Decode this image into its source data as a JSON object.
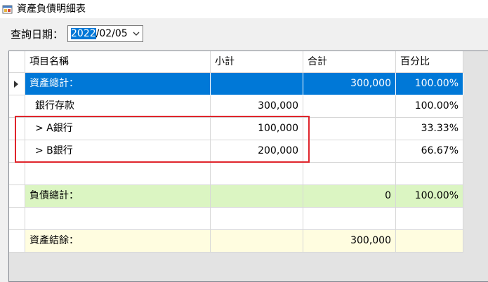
{
  "window": {
    "title": "資產負債明細表"
  },
  "filter": {
    "date_label": "查詢日期：",
    "date_year": "2022",
    "date_rest": "/02/05"
  },
  "grid": {
    "columns": [
      "項目名稱",
      "小計",
      "合計",
      "百分比"
    ],
    "rows": [
      {
        "name": "資產總計：",
        "subtotal": "",
        "total": "300,000",
        "percent": "100.00%"
      },
      {
        "name": "銀行存款",
        "subtotal": "300,000",
        "total": "",
        "percent": "100.00%"
      },
      {
        "name": "> A銀行",
        "subtotal": "100,000",
        "total": "",
        "percent": "33.33%"
      },
      {
        "name": "> B銀行",
        "subtotal": "200,000",
        "total": "",
        "percent": "66.67%"
      },
      {
        "name": "",
        "subtotal": "",
        "total": "",
        "percent": ""
      },
      {
        "name": "負債總計：",
        "subtotal": "",
        "total": "0",
        "percent": "100.00%"
      },
      {
        "name": "",
        "subtotal": "",
        "total": "",
        "percent": ""
      },
      {
        "name": "資產結餘：",
        "subtotal": "",
        "total": "300,000",
        "percent": ""
      }
    ]
  },
  "colors": {
    "selected": "#0078d7",
    "liability": "#dbf5c2",
    "balance": "#fffde0",
    "annotation": "#e0252c"
  }
}
